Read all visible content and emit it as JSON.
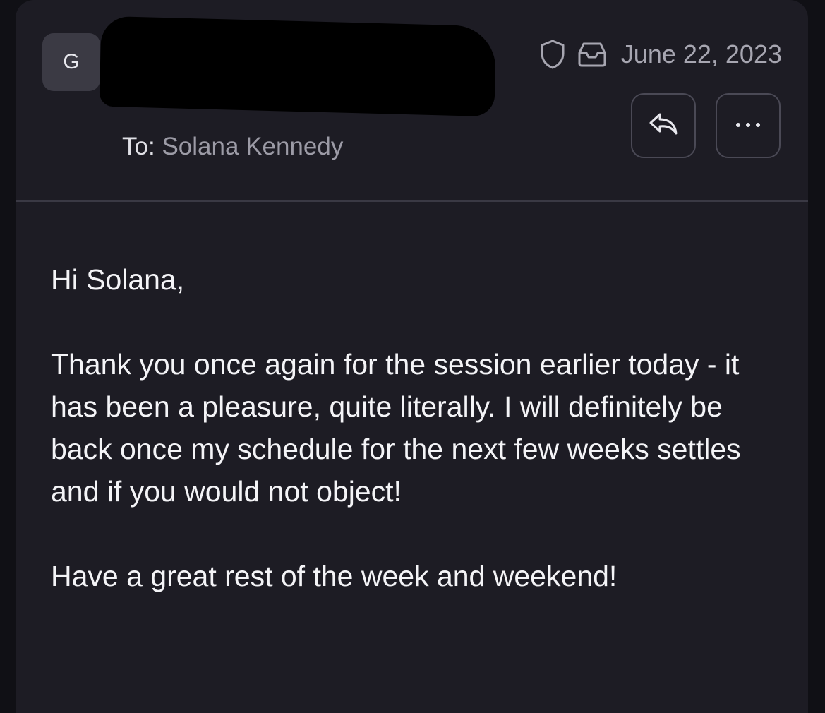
{
  "sender": {
    "avatar_initial": "G",
    "name_redacted": true
  },
  "recipient": {
    "label": "To:",
    "name": "Solana Kennedy"
  },
  "meta": {
    "date": "June 22, 2023",
    "icons": [
      "shield-icon",
      "inbox-icon"
    ]
  },
  "actions": {
    "reply_icon": "reply-icon",
    "more_icon": "more-icon"
  },
  "message": {
    "greeting": "Hi Solana,",
    "paragraph": "Thank you once again for the session earlier today - it has been a pleasure, quite literally. I will definitely be back once my schedule for the next few weeks settles and if you would not object!",
    "closing": "Have a great rest of the week and weekend!"
  },
  "colors": {
    "background": "#1d1c24",
    "text": "#f4f4f7",
    "muted_text": "#a7a6b1",
    "border": "#4a4955"
  }
}
